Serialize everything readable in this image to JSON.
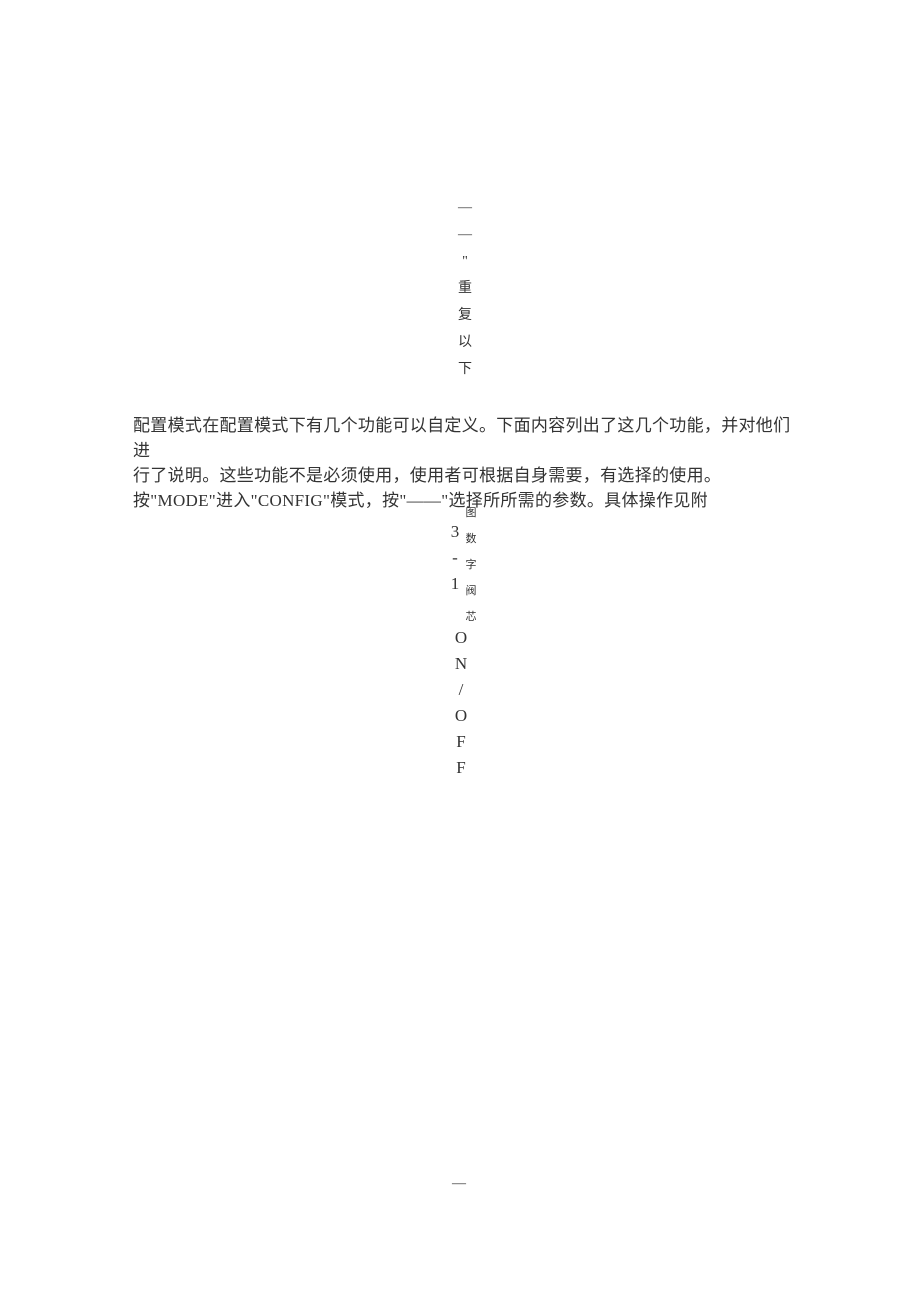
{
  "vertical1": {
    "chars": [
      "—",
      "—",
      "\"",
      "重",
      "复",
      "以",
      "下"
    ]
  },
  "paragraph": {
    "line1": "配置模式在配置模式下有几个功能可以自定义。下面内容列出了这几个功能，并对他们进",
    "line2": "行了说明。这些功能不是必须使用，使用者可根据自身需要，有选择的使用。",
    "line3": "按\"MODE\"进入\"CONFIG\"模式，按\"——\"选择所所需的参数。具体操作见附"
  },
  "vertical2": {
    "leftCol": [
      "3",
      "-",
      "1"
    ],
    "rightCol": [
      "图",
      "数",
      "字",
      "阀",
      "芯"
    ],
    "centerCol": [
      "O",
      "N",
      "/",
      "O",
      "F",
      "F"
    ]
  },
  "footer": "—"
}
